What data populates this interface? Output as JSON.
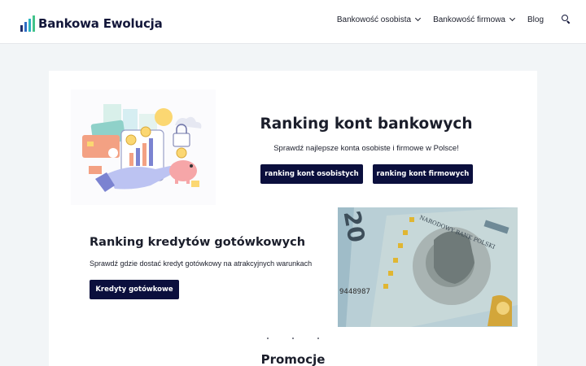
{
  "header": {
    "logo_text": "Bankowa Ewolucja",
    "nav": [
      {
        "label": "Bankowość osobista",
        "dropdown": true
      },
      {
        "label": "Bankowość firmowa",
        "dropdown": true
      },
      {
        "label": "Blog",
        "dropdown": false
      }
    ],
    "search_icon": "search-icon",
    "logo_colors": [
      "#1f2d6b",
      "#2f6cc6",
      "#2bb3c0",
      "#43c38a"
    ]
  },
  "hero": {
    "title": "Ranking kont bankowych",
    "subtitle": "Sprawdź najlepsze konta osobiste i firmowe w Polsce!",
    "button_personal": "ranking kont osobistych",
    "button_business": "ranking kont firmowych"
  },
  "loans": {
    "title": "Ranking kredytów gotówkowych",
    "subtitle": "Sprawdź gdzie dostać kredyt gotówkowy na atrakcyjnych warunkach",
    "button": "Kredyty gotówkowe"
  },
  "banknote": {
    "corner_text": "20",
    "serial": "9448987",
    "bank_text": "NARODOWY BANK POLSKI"
  },
  "promo": {
    "title": "Promocje"
  },
  "colors": {
    "accent": "#0b0f3d",
    "page_bg": "#f2f5f7"
  }
}
